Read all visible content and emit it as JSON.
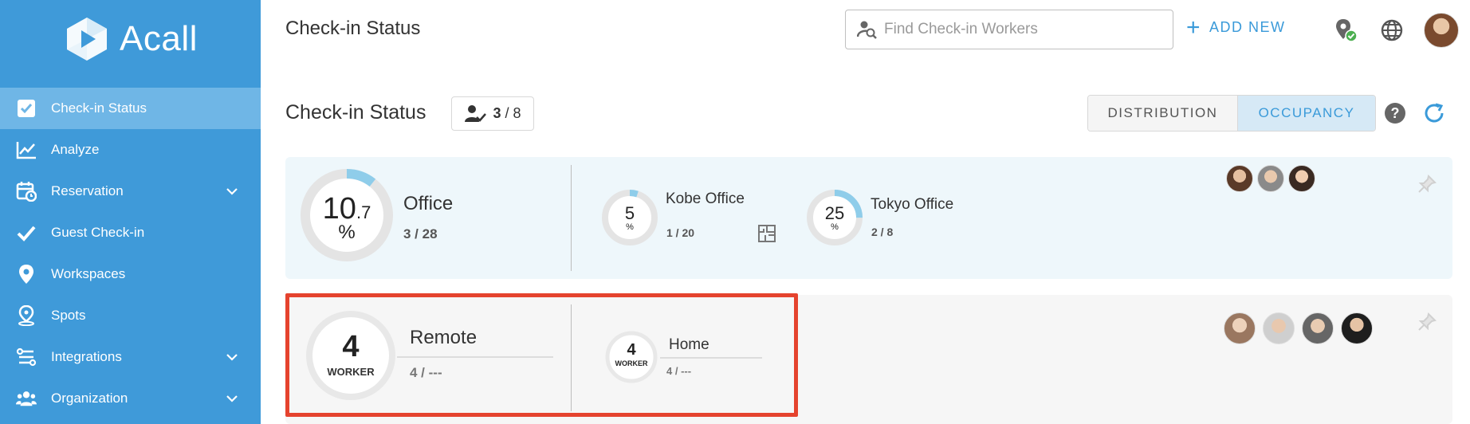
{
  "app": {
    "name": "Acall"
  },
  "sidebar": {
    "items": [
      {
        "label": "Check-in Status",
        "icon": "check-square-icon",
        "active": true,
        "expandable": false
      },
      {
        "label": "Analyze",
        "icon": "line-chart-icon",
        "active": false,
        "expandable": false
      },
      {
        "label": "Reservation",
        "icon": "calendar-clock-icon",
        "active": false,
        "expandable": true
      },
      {
        "label": "Guest Check-in",
        "icon": "checkmark-icon",
        "active": false,
        "expandable": false
      },
      {
        "label": "Workspaces",
        "icon": "location-pin-icon",
        "active": false,
        "expandable": false
      },
      {
        "label": "Spots",
        "icon": "spot-pin-icon",
        "active": false,
        "expandable": false
      },
      {
        "label": "Integrations",
        "icon": "integrations-icon",
        "active": false,
        "expandable": true
      },
      {
        "label": "Organization",
        "icon": "people-icon",
        "active": false,
        "expandable": true
      }
    ]
  },
  "header": {
    "title": "Check-in Status",
    "search_placeholder": "Find Check-in Workers",
    "add_new_label": "ADD NEW"
  },
  "status_bar": {
    "title": "Check-in Status",
    "checked_in": "3",
    "total": "/ 8",
    "tabs": {
      "distribution": "DISTRIBUTION",
      "occupancy": "OCCUPANCY"
    },
    "active_tab": "occupancy"
  },
  "office": {
    "percent_int": "10",
    "percent_dec": ".7",
    "percent_sign": "%",
    "occupancy_fraction": 0.107,
    "name": "Office",
    "count": "3 / 28",
    "locations": [
      {
        "value": "5",
        "unit": "%",
        "occupancy_fraction": 0.05,
        "name": "Kobe Office",
        "count": "1 / 20"
      },
      {
        "value": "25",
        "unit": "%",
        "occupancy_fraction": 0.25,
        "name": "Tokyo Office",
        "count": "2 / 8"
      }
    ]
  },
  "remote": {
    "value": "4",
    "unit": "WORKER",
    "name": "Remote",
    "count": "4 / ---",
    "locations": [
      {
        "value": "4",
        "unit": "WORKER",
        "name": "Home",
        "count": "4 / ---"
      }
    ]
  },
  "colors": {
    "sidebar": "#3f9ad9",
    "sidebar_active": "#6fb6e6",
    "accent": "#3a9ad9",
    "ring_track": "#e4e4e4",
    "ring_fill": "#8fcdea",
    "highlight": "#e5432e"
  }
}
